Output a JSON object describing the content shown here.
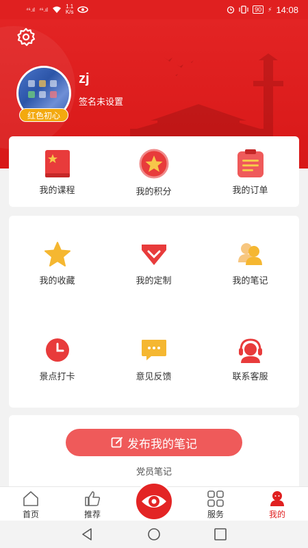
{
  "status_bar": {
    "signal1": "⁴⁶.ıl",
    "signal2": "⁴⁶.ıl",
    "speed_value": "1.1",
    "speed_unit": "K/s",
    "battery": "90",
    "time": "14:08"
  },
  "profile": {
    "username": "zj",
    "signature": "签名未设置",
    "badge": "红色初心"
  },
  "quick_menu": [
    {
      "label": "我的课程",
      "icon": "book-icon"
    },
    {
      "label": "我的积分",
      "icon": "star-coin-icon"
    },
    {
      "label": "我的订单",
      "icon": "order-list-icon"
    }
  ],
  "grid_menu": [
    {
      "label": "我的收藏",
      "icon": "star-icon"
    },
    {
      "label": "我的定制",
      "icon": "gem-icon"
    },
    {
      "label": "我的笔记",
      "icon": "people-icon"
    },
    {
      "label": "景点打卡",
      "icon": "clock-icon"
    },
    {
      "label": "意见反馈",
      "icon": "message-icon"
    },
    {
      "label": "联系客服",
      "icon": "headset-icon"
    }
  ],
  "notes": {
    "button_label": "发布我的笔记",
    "caption": "党员笔记"
  },
  "tabs": [
    {
      "label": "首页",
      "icon": "home-icon",
      "active": false
    },
    {
      "label": "推荐",
      "icon": "thumb-up-icon",
      "active": false
    },
    {
      "label": "服务",
      "icon": "grid-icon",
      "active": false
    },
    {
      "label": "我的",
      "icon": "user-icon",
      "active": true
    }
  ],
  "colors": {
    "primary_red": "#e02020",
    "button_red": "#ef5a5a",
    "badge_orange": "#f3a90f",
    "icon_yellow": "#f5b731"
  }
}
